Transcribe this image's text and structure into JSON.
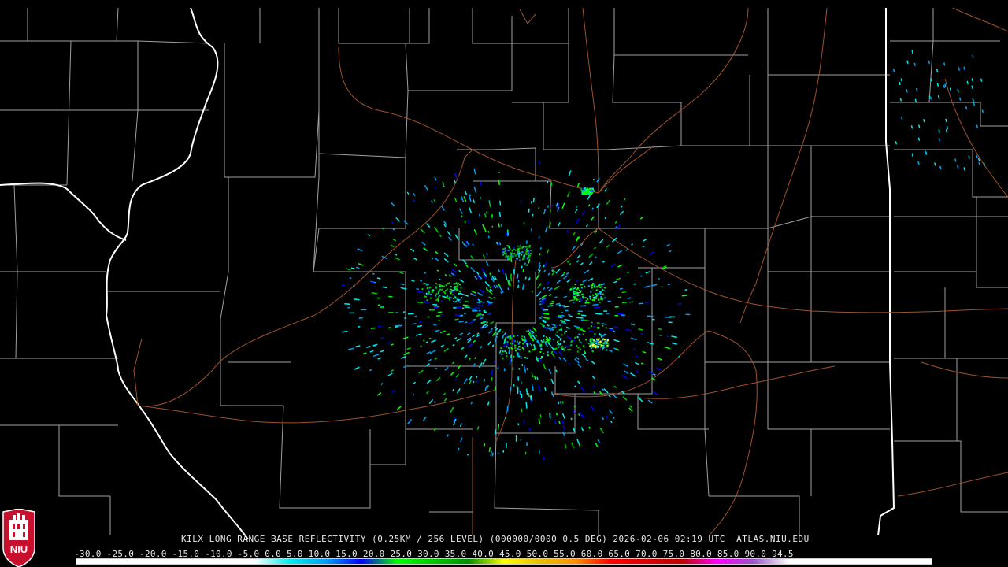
{
  "caption": "KILX LONG RANGE BASE REFLECTIVITY (0.25KM / 256 LEVEL) (000000/0000 0.5 DEG) 2026-02-06 02:19 UTC  ATLAS.NIU.EDU",
  "color_scale": {
    "labels": [
      "-30.0",
      "-25.0",
      "-20.0",
      "-15.0",
      "-10.0",
      "-5.0",
      "0.0",
      "5.0",
      "10.0",
      "15.0",
      "20.0",
      "25.0",
      "30.0",
      "35.0",
      "40.0",
      "45.0",
      "50.0",
      "55.0",
      "60.0",
      "65.0",
      "70.0",
      "75.0",
      "80.0",
      "85.0",
      "90.0",
      "94.5"
    ],
    "colors": [
      "#ffffff",
      "#ffffff",
      "#ffffff",
      "#ffffff",
      "#ffffff",
      "#ffffff",
      "#00ecec",
      "#01a0f6",
      "#0000f6",
      "#00ff00",
      "#00c800",
      "#009000",
      "#ffff00",
      "#e7c000",
      "#ff9000",
      "#ff0000",
      "#d60000",
      "#c00000",
      "#ff00ff",
      "#9955c9",
      "#ffffff",
      "#ffffff",
      "#ffffff",
      "#ffffff",
      "#ffffff"
    ]
  },
  "logo": {
    "text": "NIU",
    "color": "#c8102e"
  }
}
